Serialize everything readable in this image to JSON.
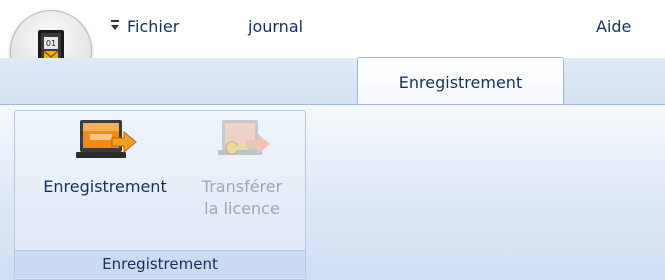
{
  "app": {
    "icon": "app-orb-icon",
    "quick_access": "customize-quick-access-icon"
  },
  "tabs": [
    {
      "label": "Fichier"
    },
    {
      "label": "journal"
    },
    {
      "label": "Enregistrement",
      "active": true
    },
    {
      "label": "Aide"
    }
  ],
  "ribbon": {
    "group_label": "Enregistrement",
    "buttons": [
      {
        "label": "Enregistrement",
        "icon": "registration-icon",
        "enabled": true
      },
      {
        "label_line1": "Transférer",
        "label_line2": "la licence",
        "icon": "transfer-license-icon",
        "enabled": false
      }
    ]
  },
  "colors": {
    "ribbon_text": "#15305a",
    "disabled_text": "#9aa8b8",
    "accent_orange": "#f28a14",
    "tab_strip": "#d9e6f5"
  }
}
